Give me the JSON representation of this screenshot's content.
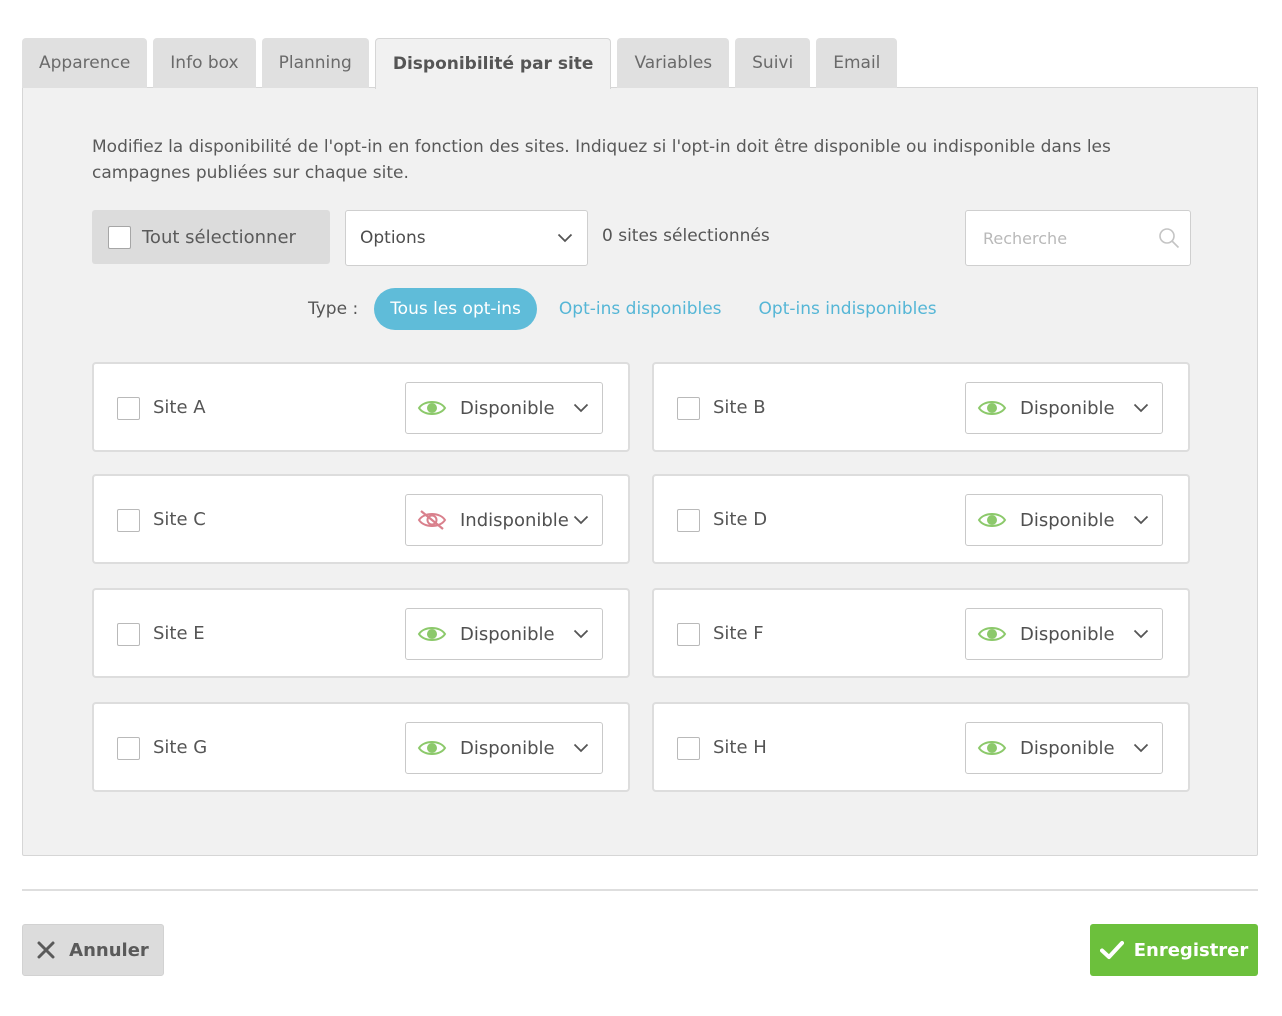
{
  "tabs": [
    {
      "label": "Apparence",
      "active": false
    },
    {
      "label": "Info box",
      "active": false
    },
    {
      "label": "Planning",
      "active": false
    },
    {
      "label": "Disponibilité par site",
      "active": true
    },
    {
      "label": "Variables",
      "active": false
    },
    {
      "label": "Suivi",
      "active": false
    },
    {
      "label": "Email",
      "active": false
    }
  ],
  "description": "Modifiez la disponibilité de l'opt-in en fonction des sites. Indiquez si l'opt-in doit être disponible ou indisponible dans les campagnes publiées sur chaque site.",
  "toolbar": {
    "select_all_label": "Tout sélectionner",
    "options_label": "Options",
    "selected_count": "0 sites sélectionnés",
    "search_placeholder": "Recherche"
  },
  "filter": {
    "label": "Type :",
    "options": [
      {
        "label": "Tous les opt-ins",
        "active": true
      },
      {
        "label": "Opt-ins disponibles",
        "active": false
      },
      {
        "label": "Opt-ins indisponibles",
        "active": false
      }
    ]
  },
  "sites": [
    {
      "name": "Site A",
      "status": "Disponible",
      "available": true
    },
    {
      "name": "Site B",
      "status": "Disponible",
      "available": true
    },
    {
      "name": "Site C",
      "status": "Indisponible",
      "available": false
    },
    {
      "name": "Site D",
      "status": "Disponible",
      "available": true
    },
    {
      "name": "Site E",
      "status": "Disponible",
      "available": true
    },
    {
      "name": "Site F",
      "status": "Disponible",
      "available": true
    },
    {
      "name": "Site G",
      "status": "Disponible",
      "available": true
    },
    {
      "name": "Site H",
      "status": "Disponible",
      "available": true
    }
  ],
  "footer": {
    "cancel_label": "Annuler",
    "save_label": "Enregistrer"
  },
  "colors": {
    "accent_blue": "#5fbcd9",
    "available_green": "#8cc96b",
    "unavailable_red": "#d9808c",
    "save_green": "#6cc03c"
  },
  "icons": {
    "available": "eye-icon",
    "unavailable": "eye-slash-icon",
    "dropdown": "chevron-down-icon",
    "search": "search-icon",
    "cancel": "close-icon",
    "save": "check-icon"
  }
}
